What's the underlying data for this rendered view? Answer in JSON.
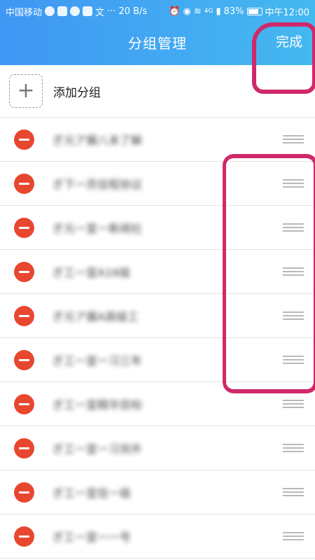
{
  "status_bar": {
    "carrier": "中国移动",
    "speed": "20 B/s",
    "network": "4G",
    "battery": "83%",
    "time": "中午12:00"
  },
  "header": {
    "title": "分组管理",
    "done_label": "完成"
  },
  "add_group": {
    "plus": "+",
    "label": "添加分组"
  },
  "groups": [
    {
      "name": "ぎ元ア展八未了解"
    },
    {
      "name": "ぎ下一员信程协议"
    },
    {
      "name": "ぎ元一宣一新闻社"
    },
    {
      "name": "ぎ工一宣A16级"
    },
    {
      "name": "ぎ元ア展A高级工"
    },
    {
      "name": "ぎ工一宣一习三年"
    },
    {
      "name": "ぎ工一宣精华目标"
    },
    {
      "name": "ぎ工一宣一习另外"
    },
    {
      "name": "ぎ工一宣信一级"
    },
    {
      "name": "ぎ工一宣一一号"
    }
  ],
  "colors": {
    "header_start": "#3f97f3",
    "header_end": "#45b8f0",
    "remove": "#e8472f",
    "annotation": "#d0286a"
  }
}
